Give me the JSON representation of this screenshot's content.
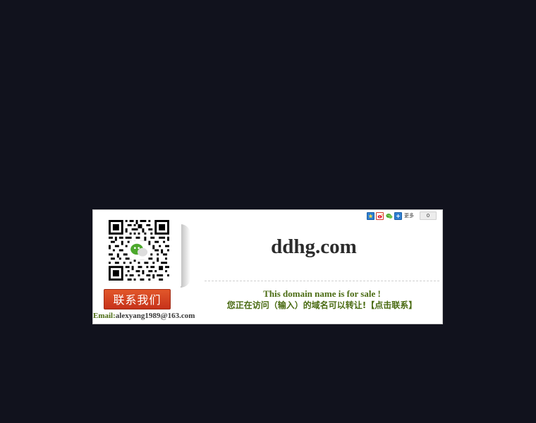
{
  "page": {
    "domain_name": "ddhg.com",
    "sale_text_en": "This domain name is for sale !",
    "sale_text_cn": "您正在访问（输入）的域名可以转让!",
    "contact_link": "【点击联系】"
  },
  "contact": {
    "button_label": "联系我们",
    "email_label": "Email:",
    "email_value": "alexyang1989@163.com"
  },
  "share": {
    "icons": [
      "qzone-icon",
      "weibo-icon",
      "wechat-icon",
      "more-plus-icon"
    ],
    "more_label": "更多",
    "count": "0"
  },
  "colors": {
    "page_background": "#11121d",
    "card_background": "#ffffff",
    "accent_green": "#4a6b12",
    "button_red": "#d4401f"
  }
}
